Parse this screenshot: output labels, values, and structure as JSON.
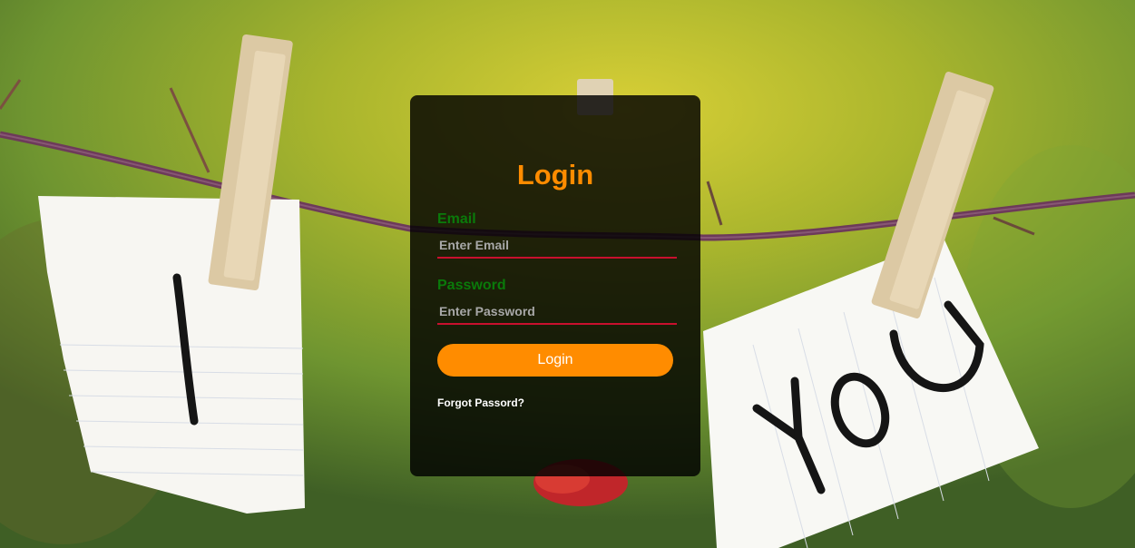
{
  "login": {
    "title": "Login",
    "email": {
      "label": "Email",
      "placeholder": "Enter Email",
      "value": ""
    },
    "password": {
      "label": "Password",
      "placeholder": "Enter Password",
      "value": ""
    },
    "submit_label": "Login",
    "forgot_label": "Forgot Passord?"
  },
  "background": {
    "left_note_text": "I",
    "right_note_text": "YOU"
  },
  "colors": {
    "accent": "#ff8c00",
    "label_green": "#0a7a0a",
    "underline_red": "#c8102e",
    "card_bg": "rgba(0,0,0,0.82)"
  }
}
